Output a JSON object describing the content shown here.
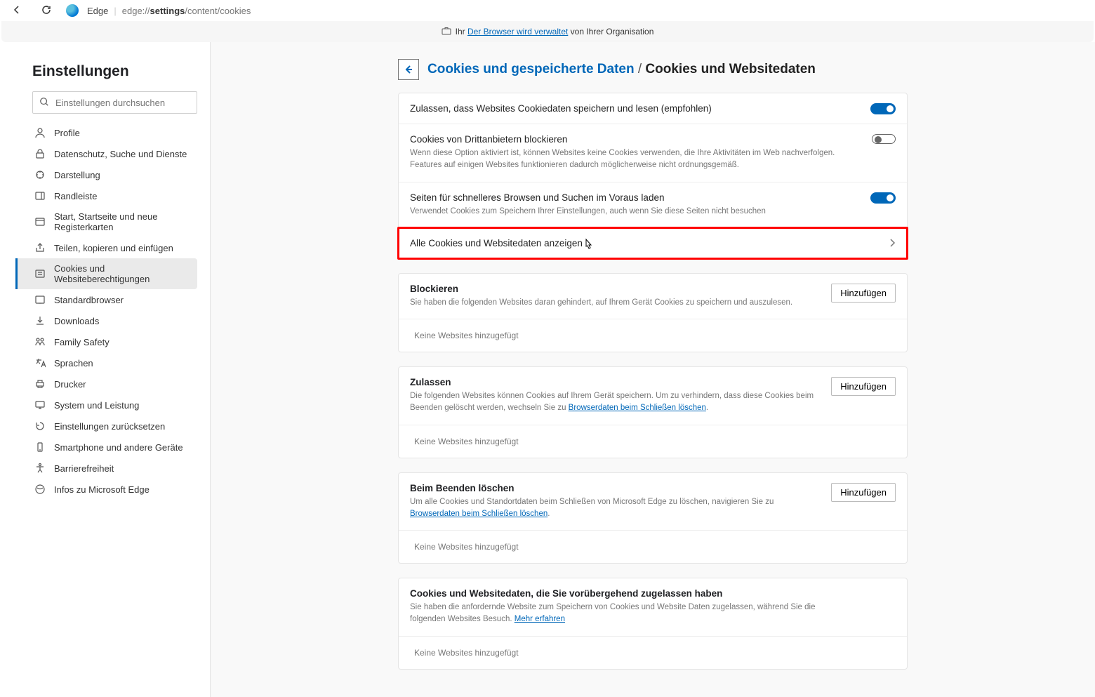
{
  "toolbar": {
    "edge_label": "Edge",
    "addr_prefix": "edge://",
    "addr_bold": "settings",
    "addr_suffix": "/content/cookies"
  },
  "managed_bar": {
    "prefix": "Ihr ",
    "link": "Der Browser wird verwaltet",
    "suffix": " von Ihrer Organisation"
  },
  "sidebar": {
    "title": "Einstellungen",
    "search_placeholder": "Einstellungen durchsuchen",
    "items": [
      {
        "label": "Profile",
        "icon": "profile"
      },
      {
        "label": "Datenschutz, Suche und Dienste",
        "icon": "lock"
      },
      {
        "label": "Darstellung",
        "icon": "appearance"
      },
      {
        "label": "Randleiste",
        "icon": "sidebar"
      },
      {
        "label": "Start, Startseite und neue Registerkarten",
        "icon": "home"
      },
      {
        "label": "Teilen, kopieren und einfügen",
        "icon": "share"
      },
      {
        "label": "Cookies und Websiteberechtigungen",
        "icon": "cookies",
        "active": true
      },
      {
        "label": "Standardbrowser",
        "icon": "default"
      },
      {
        "label": "Downloads",
        "icon": "download"
      },
      {
        "label": "Family Safety",
        "icon": "family"
      },
      {
        "label": "Sprachen",
        "icon": "lang"
      },
      {
        "label": "Drucker",
        "icon": "printer"
      },
      {
        "label": "System und Leistung",
        "icon": "system"
      },
      {
        "label": "Einstellungen zurücksetzen",
        "icon": "reset"
      },
      {
        "label": "Smartphone und andere Geräte",
        "icon": "phone"
      },
      {
        "label": "Barrierefreiheit",
        "icon": "a11y"
      },
      {
        "label": "Infos zu Microsoft Edge",
        "icon": "about"
      }
    ]
  },
  "crumb": {
    "link": "Cookies und gespeicherte Daten",
    "sep": "/",
    "current": "Cookies und Websitedaten"
  },
  "rows": {
    "allow_sites": {
      "title": "Zulassen, dass Websites Cookiedaten speichern und lesen (empfohlen)",
      "toggle": "on"
    },
    "block_3p": {
      "title": "Cookies von Drittanbietern blockieren",
      "desc": "Wenn diese Option aktiviert ist, können Websites keine Cookies verwenden, die Ihre Aktivitäten im Web nachverfolgen. Features auf einigen Websites funktionieren dadurch möglicherweise nicht ordnungsgemäß.",
      "toggle": "off"
    },
    "preload": {
      "title": "Seiten für schnelleres Browsen und Suchen im Voraus laden",
      "desc": "Verwendet Cookies zum Speichern Ihrer Einstellungen, auch wenn Sie diese Seiten nicht besuchen",
      "toggle": "on"
    },
    "all_cookies": {
      "title": "Alle Cookies und Websitedaten anzeigen"
    }
  },
  "sections": {
    "block": {
      "title": "Blockieren",
      "desc": "Sie haben die folgenden Websites daran gehindert, auf Ihrem Gerät Cookies zu speichern und auszulesen.",
      "add": "Hinzufügen",
      "empty": "Keine Websites hinzugefügt"
    },
    "allow": {
      "title": "Zulassen",
      "desc_pre": "Die folgenden Websites können Cookies auf Ihrem Gerät speichern. Um zu verhindern, dass diese Cookies beim Beenden gelöscht werden, wechseln Sie zu ",
      "desc_link": "Browserdaten beim Schließen löschen",
      "desc_post": ".",
      "add": "Hinzufügen",
      "empty": "Keine Websites hinzugefügt"
    },
    "clear_exit": {
      "title": "Beim Beenden löschen",
      "desc_pre": "Um alle Cookies und Standortdaten beim Schließen von Microsoft Edge zu löschen, navigieren Sie zu ",
      "desc_link": "Browserdaten beim Schließen löschen",
      "desc_post": ".",
      "add": "Hinzufügen",
      "empty": "Keine Websites hinzugefügt"
    },
    "temp_allowed": {
      "title": "Cookies und Websitedaten, die Sie vorübergehend zugelassen haben",
      "desc_pre": "Sie haben die anfordernde Website zum Speichern von Cookies und Website Daten zugelassen, während Sie die folgenden Websites Besuch. ",
      "desc_link": "Mehr erfahren",
      "desc_post": "",
      "empty": "Keine Websites hinzugefügt"
    }
  }
}
